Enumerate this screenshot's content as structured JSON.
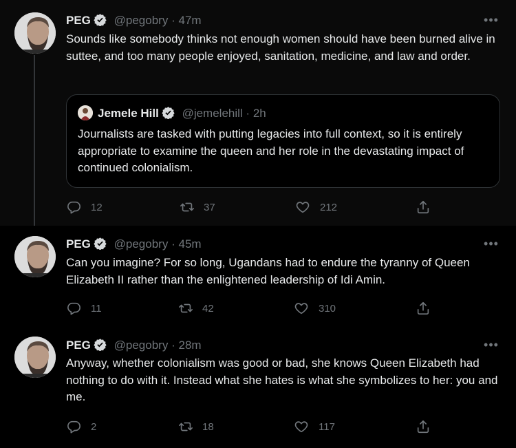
{
  "tweets": [
    {
      "name": "PEG",
      "handle": "@pegobry",
      "time": "47m",
      "text": "Sounds like somebody thinks not enough women should have been burned alive in suttee, and too many people enjoyed, sanitation, medicine, and law and order.",
      "quote": {
        "name": "Jemele Hill",
        "handle": "@jemelehill",
        "time": "2h",
        "text": "Journalists are tasked with putting legacies into full context, so it is entirely appropriate to examine the queen and her role in the devastating impact of continued colonialism."
      },
      "replies": "12",
      "retweets": "37",
      "likes": "212"
    },
    {
      "name": "PEG",
      "handle": "@pegobry",
      "time": "45m",
      "text": "Can you imagine? For so long, Ugandans had to endure the tyranny of Queen Elizabeth II rather than the enlightened leadership of Idi Amin.",
      "replies": "11",
      "retweets": "42",
      "likes": "310"
    },
    {
      "name": "PEG",
      "handle": "@pegobry",
      "time": "28m",
      "text": "Anyway, whether colonialism was good or bad, she knows Queen Elizabeth had nothing to do with it. Instead what she hates is what she symbolizes to her: you and me.",
      "replies": "2",
      "retweets": "18",
      "likes": "117"
    }
  ],
  "ui": {
    "separator": "·",
    "more": "•••"
  },
  "colors": {
    "background": "#000000",
    "text": "#e7e9ea",
    "secondary": "#71767b",
    "verified_badge": "#d6d9db",
    "border": "#2f3336"
  }
}
